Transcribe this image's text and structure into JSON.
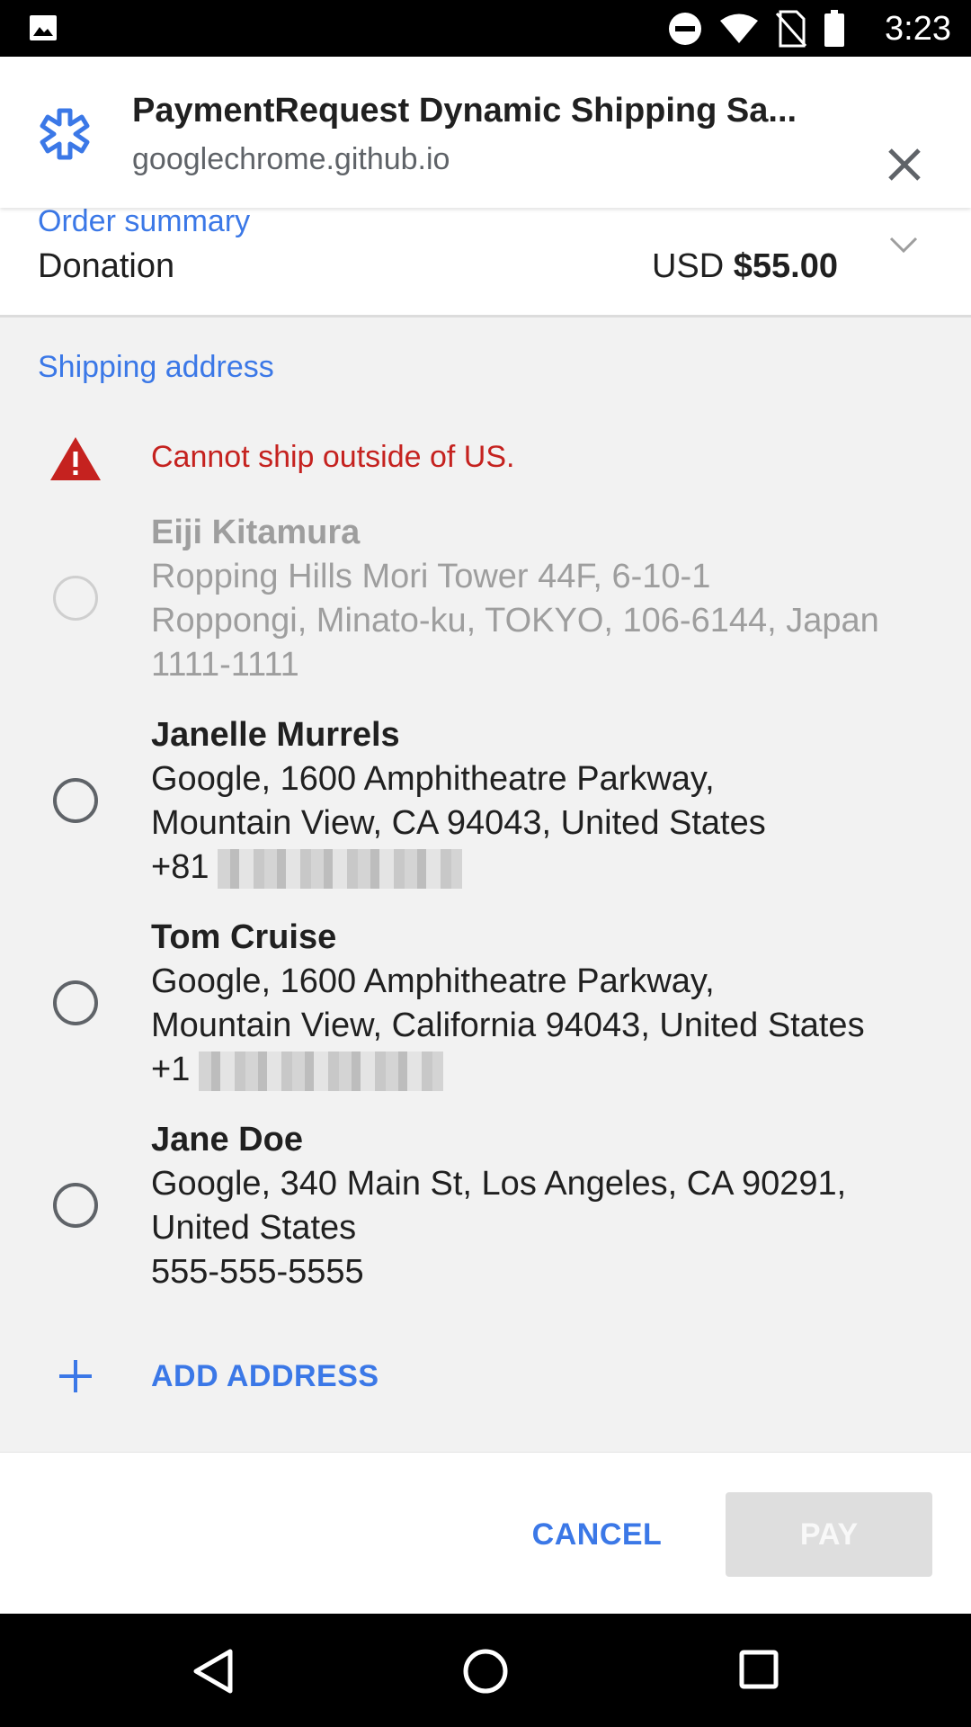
{
  "status_bar": {
    "time": "3:23",
    "icons": [
      "image-icon",
      "do-not-disturb-icon",
      "wifi-icon",
      "no-sim-icon",
      "battery-icon"
    ]
  },
  "header": {
    "title": "PaymentRequest Dynamic Shipping Sa...",
    "origin": "googlechrome.github.io",
    "site_icon": "asterisk-icon",
    "close_icon": "close-icon"
  },
  "order_summary": {
    "label": "Order summary",
    "item": "Donation",
    "currency": "USD",
    "total": "$55.00"
  },
  "shipping": {
    "label": "Shipping address",
    "error": "Cannot ship outside of US.",
    "addresses": [
      {
        "name": "Eiji Kitamura",
        "line1": "Ropping Hills Mori Tower 44F, 6-10-1",
        "line2": "Roppongi, Minato-ku, TOKYO, 106-6144, Japan",
        "phone": "1111-1111",
        "enabled": false
      },
      {
        "name": "Janelle Murrels",
        "line1": "Google, 1600 Amphitheatre Parkway,",
        "line2": "Mountain View, CA 94043, United States",
        "phone": "+81",
        "enabled": true
      },
      {
        "name": "Tom Cruise",
        "line1": "Google, 1600 Amphitheatre Parkway,",
        "line2": "Mountain View, California 94043, United States",
        "phone": "+1",
        "enabled": true
      },
      {
        "name": "Jane Doe",
        "line1": "Google, 340 Main St, Los Angeles, CA 90291,",
        "line2": "United States",
        "phone": "555-555-5555",
        "enabled": true
      }
    ],
    "add_label": "ADD ADDRESS"
  },
  "footer": {
    "cancel": "CANCEL",
    "pay": "PAY"
  },
  "colors": {
    "accent": "#3b78e7",
    "error": "#c5221f",
    "disabled_text": "#9e9e9e",
    "pay_disabled_bg": "#dedede"
  }
}
